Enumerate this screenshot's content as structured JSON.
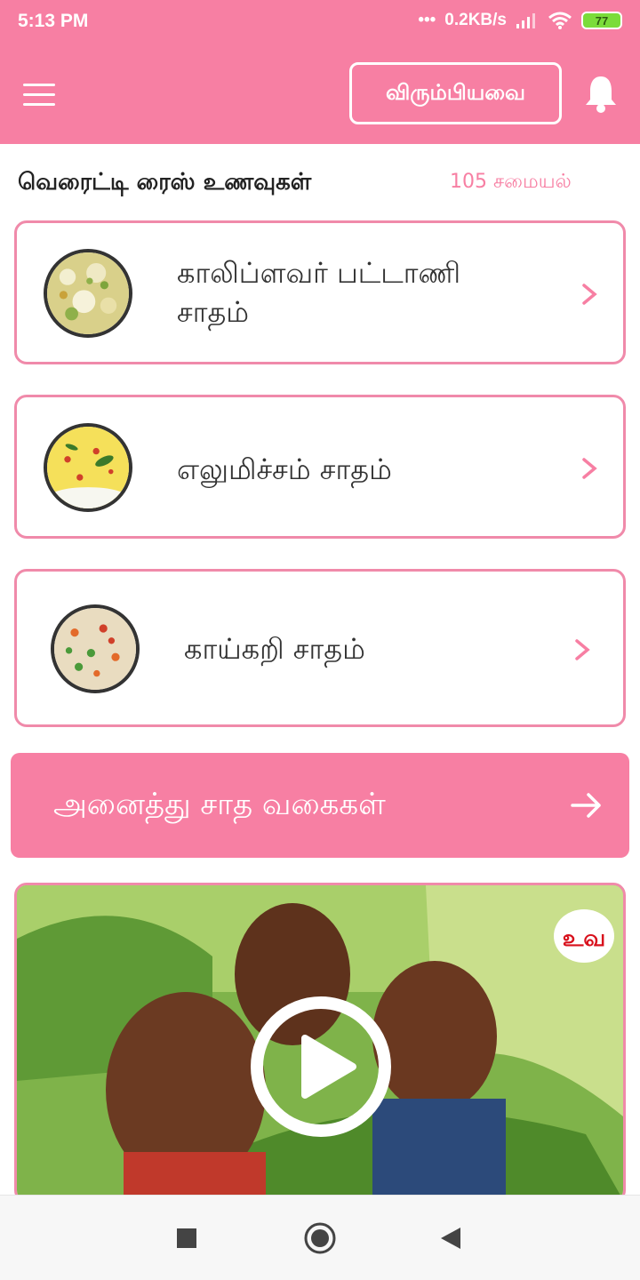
{
  "status_bar": {
    "time": "5:13 PM",
    "dots": "•••",
    "network_speed": "0.2KB/s",
    "battery": "77"
  },
  "app_bar": {
    "menu_icon": "hamburger-menu-icon",
    "favorites_label": "விரும்பியவை",
    "notification_icon": "bell-icon"
  },
  "section": {
    "title": "வெரைட்டி ரைஸ் உணவுகள்",
    "count": "105 சமையல்"
  },
  "recipes": [
    {
      "title_line1": "காலிப்ளவர் பட்டாணி",
      "title_line2": "சாதம்",
      "icon": "chevron-right-icon"
    },
    {
      "title": "எலுமிச்சம் சாதம்",
      "icon": "chevron-right-icon"
    },
    {
      "title": "காய்கறி சாதம்",
      "icon": "chevron-right-icon"
    }
  ],
  "all_button": {
    "label": "அனைத்து சாத வகைகள்",
    "icon": "arrow-right-icon"
  },
  "video": {
    "icon": "play-icon",
    "logo_text": "உவ"
  },
  "colors": {
    "primary": "#f77fa3",
    "card_border": "#f08aaa",
    "text": "#333333"
  },
  "nav_bar": {
    "icons": [
      "square-recents-icon",
      "circle-home-icon",
      "triangle-back-icon"
    ]
  }
}
